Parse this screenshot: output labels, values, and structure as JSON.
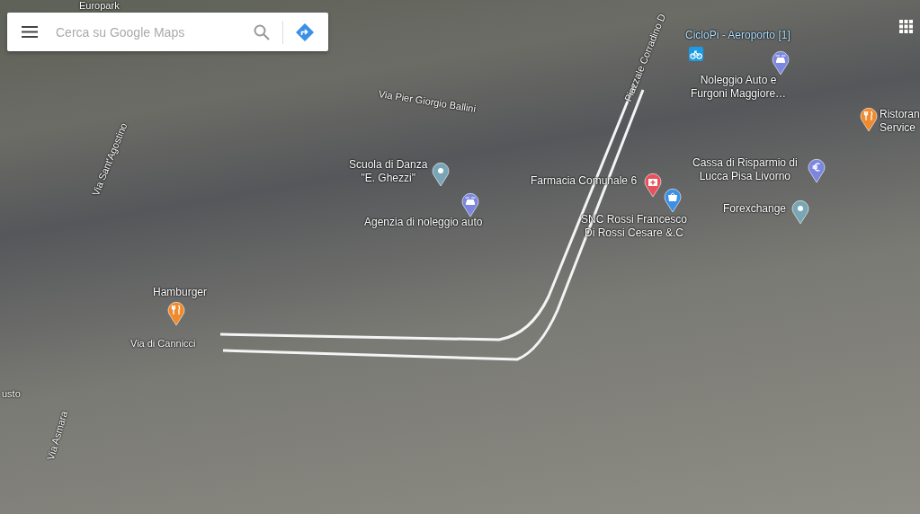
{
  "search": {
    "placeholder": "Cerca su Google Maps"
  },
  "streets": [
    {
      "name": "Europark"
    },
    {
      "name": "Via Pier Giorgio Ballini"
    },
    {
      "name": "Piazzale Corradino D"
    },
    {
      "name": "Via Sant'Agostino"
    },
    {
      "name": "Via di Cannicci"
    },
    {
      "name": "usto"
    },
    {
      "name": "Via Asmara"
    }
  ],
  "places": [
    {
      "lines": [
        "CicloPi - Aeroporto [1]"
      ],
      "kind": "bike",
      "color": "#1a9be6"
    },
    {
      "lines": [
        "Noleggio Auto e",
        "Furgoni Maggiore…"
      ],
      "kind": "car",
      "color": "#7b86e0"
    },
    {
      "lines": [
        "Ristoran",
        "Service"
      ],
      "kind": "food",
      "color": "#f08a2c"
    },
    {
      "lines": [
        "Scuola di Danza",
        "\"E. Ghezzi\""
      ],
      "kind": "dot",
      "color": "#78a6b5"
    },
    {
      "lines": [
        "Farmacia Comunale 6"
      ],
      "kind": "cross",
      "color": "#e8505b"
    },
    {
      "lines": [
        "Agenzia di noleggio auto"
      ],
      "kind": "car",
      "color": "#7b86e0"
    },
    {
      "lines": [
        "SNC Rossi Francesco",
        "Di Rossi Cesare &.C"
      ],
      "kind": "bag",
      "color": "#3b8fe6"
    },
    {
      "lines": [
        "Cassa di Risparmio di",
        "Lucca Pisa Livorno"
      ],
      "kind": "euro",
      "color": "#7b86e0"
    },
    {
      "lines": [
        "Forexchange"
      ],
      "kind": "dot",
      "color": "#78a6b5"
    },
    {
      "lines": [
        "Hamburger"
      ],
      "kind": "food",
      "color": "#f08a2c"
    }
  ]
}
